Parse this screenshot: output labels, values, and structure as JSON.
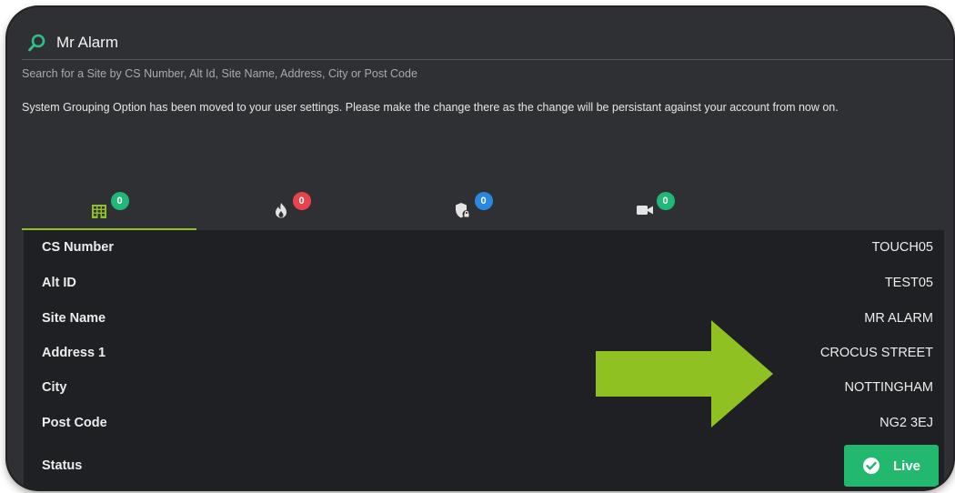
{
  "search": {
    "query": "Mr Alarm",
    "hint": "Search for a Site by CS Number, Alt Id, Site Name, Address, City or Post Code"
  },
  "notice": "System Grouping Option has been moved to your user settings. Please make the change there as the change will be persistant against your account from now on.",
  "tabs": [
    {
      "icon": "building-icon",
      "count": "0",
      "badge_color": "#21b67a",
      "active": true
    },
    {
      "icon": "fire-icon",
      "count": "0",
      "badge_color": "#e8424d",
      "active": false
    },
    {
      "icon": "shield-lock-icon",
      "count": "0",
      "badge_color": "#2a87e0",
      "active": false
    },
    {
      "icon": "video-camera-icon",
      "count": "0",
      "badge_color": "#21b67a",
      "active": false
    }
  ],
  "details": [
    {
      "label": "CS Number",
      "value": "TOUCH05"
    },
    {
      "label": "Alt ID",
      "value": "TEST05"
    },
    {
      "label": "Site Name",
      "value": "MR ALARM"
    },
    {
      "label": "Address 1",
      "value": "CROCUS STREET"
    },
    {
      "label": "City",
      "value": "NOTTINGHAM"
    },
    {
      "label": "Post Code",
      "value": "NG2 3EJ"
    }
  ],
  "status": {
    "label": "Status",
    "value": "Live"
  },
  "colors": {
    "accent_green": "#8fc122",
    "status_green": "#22b86d",
    "arrow_green": "#8fc122"
  }
}
